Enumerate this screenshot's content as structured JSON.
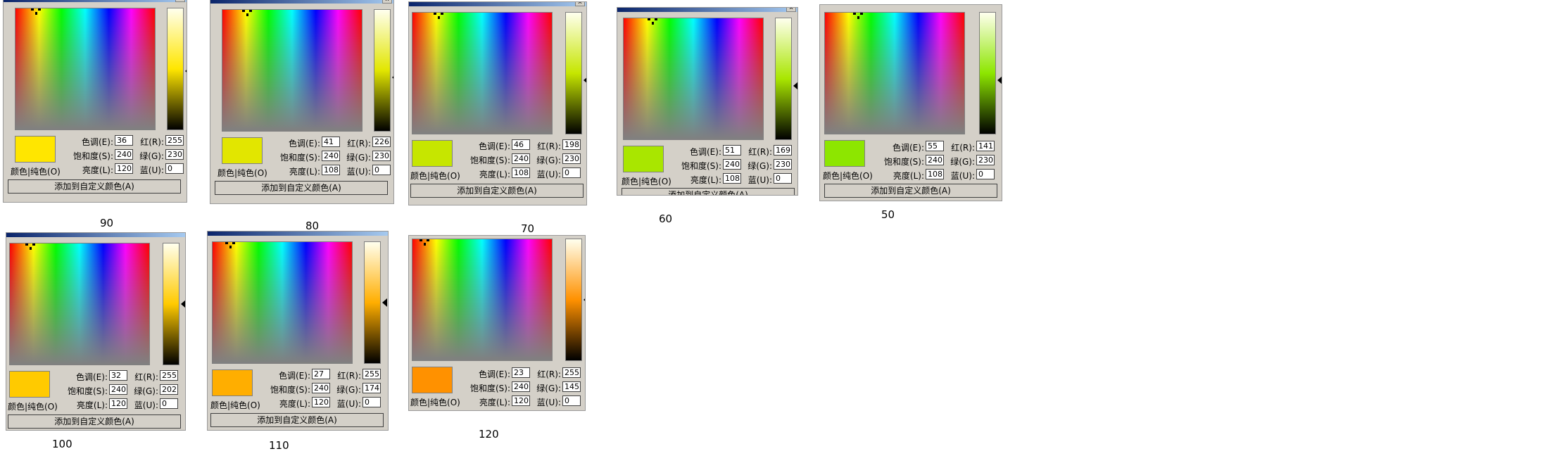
{
  "labels": {
    "hue": "色调(E):",
    "sat": "饱和度(S):",
    "lum": "亮度(L):",
    "red": "红(R):",
    "green": "绿(G):",
    "blue": "蓝(U):",
    "color_solid": "颜色|纯色(O)",
    "add_custom": "添加到自定义颜色(A)",
    "close": "x"
  },
  "dialogs": [
    {
      "caption": "90",
      "hue": "36",
      "sat": "240",
      "lum": "120",
      "red": "255",
      "green": "230",
      "blue": "0",
      "swatch": "#ffe600",
      "lumtop": "#ffffee",
      "lummid": "#ffe600",
      "lumpos": 0.52
    },
    {
      "caption": "80",
      "hue": "41",
      "sat": "240",
      "lum": "108",
      "red": "226",
      "green": "230",
      "blue": "0",
      "swatch": "#e2e600",
      "lumtop": "#ffffee",
      "lummid": "#e2e600",
      "lumpos": 0.56
    },
    {
      "caption": "70",
      "hue": "46",
      "sat": "240",
      "lum": "108",
      "red": "198",
      "green": "230",
      "blue": "0",
      "swatch": "#c6e600",
      "lumtop": "#ffffee",
      "lummid": "#c6e600",
      "lumpos": 0.56
    },
    {
      "caption": "60",
      "hue": "51",
      "sat": "240",
      "lum": "108",
      "red": "169",
      "green": "230",
      "blue": "0",
      "swatch": "#a9e600",
      "lumtop": "#ffffee",
      "lummid": "#a9e600",
      "lumpos": 0.56
    },
    {
      "caption": "50",
      "hue": "55",
      "sat": "240",
      "lum": "108",
      "red": "141",
      "green": "230",
      "blue": "0",
      "swatch": "#8de600",
      "lumtop": "#ffffee",
      "lummid": "#8de600",
      "lumpos": 0.56
    },
    {
      "caption": "100",
      "hue": "32",
      "sat": "240",
      "lum": "120",
      "red": "255",
      "green": "202",
      "blue": "0",
      "swatch": "#ffca00",
      "lumtop": "#ffffee",
      "lummid": "#ffca00",
      "lumpos": 0.5
    },
    {
      "caption": "110",
      "hue": "27",
      "sat": "240",
      "lum": "120",
      "red": "255",
      "green": "174",
      "blue": "0",
      "swatch": "#ffae00",
      "lumtop": "#ffffee",
      "lummid": "#ffae00",
      "lumpos": 0.5
    },
    {
      "caption": "120",
      "hue": "23",
      "sat": "240",
      "lum": "120",
      "red": "255",
      "green": "145",
      "blue": "0",
      "swatch": "#ff9100",
      "lumtop": "#ffffee",
      "lummid": "#ff9100",
      "lumpos": 0.5
    }
  ]
}
